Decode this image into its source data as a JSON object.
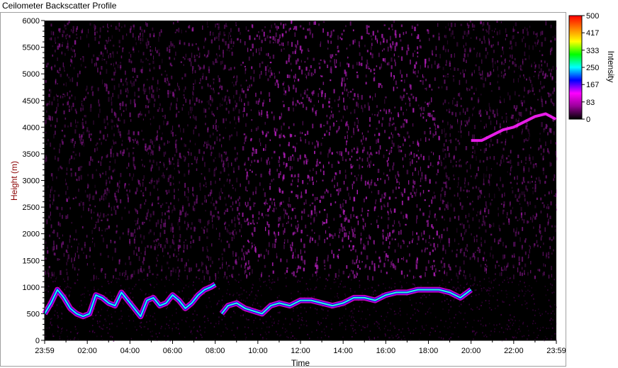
{
  "window": {
    "title": "Ceilometer Backscatter Profile"
  },
  "chart_data": {
    "type": "heatmap",
    "title": "",
    "xlabel": "Time",
    "ylabel": "Height (m)",
    "colorbar_label": "Intensity",
    "x_ticks": [
      "23:59",
      "02:00",
      "04:00",
      "06:00",
      "08:00",
      "10:00",
      "12:00",
      "14:00",
      "16:00",
      "18:00",
      "20:00",
      "22:00",
      "23:59"
    ],
    "y_ticks": [
      0,
      500,
      1000,
      1500,
      2000,
      2500,
      3000,
      3500,
      4000,
      4500,
      5000,
      5500,
      6000
    ],
    "ylim": [
      0,
      6000
    ],
    "xlim_hours": [
      0,
      24
    ],
    "colorbar_ticks": [
      500,
      417,
      333,
      250,
      167,
      83,
      0
    ],
    "colorbar_range": [
      0,
      500
    ],
    "colorbar_colors": [
      "#000000",
      "#9a009a",
      "#ff00ff",
      "#0000ff",
      "#00ffff",
      "#00ff00",
      "#ffff00",
      "#ff8000",
      "#ff0000"
    ],
    "background_noise_top_m": 6000,
    "dense_noise_ceiling_m": 1200,
    "cloud_base_layer": {
      "time_h": [
        0.0,
        0.3,
        0.6,
        0.9,
        1.2,
        1.5,
        1.8,
        2.1,
        2.4,
        2.7,
        3.0,
        3.3,
        3.6,
        3.9,
        4.2,
        4.5,
        4.8,
        5.1,
        5.4,
        5.7,
        6.0,
        6.3,
        6.6,
        6.9,
        7.2,
        7.5,
        7.8,
        8.0
      ],
      "height_m": [
        500,
        700,
        950,
        800,
        600,
        500,
        450,
        500,
        850,
        800,
        700,
        650,
        900,
        750,
        600,
        450,
        750,
        800,
        650,
        700,
        850,
        750,
        600,
        700,
        850,
        950,
        1000,
        1050
      ]
    },
    "cloud_base_layer_2": {
      "time_h": [
        8.3,
        8.6,
        9.0,
        9.4,
        9.8,
        10.2,
        10.6,
        11.0,
        11.5,
        12.0,
        12.5,
        13.0,
        13.5,
        14.0,
        14.5,
        15.0,
        15.5,
        16.0,
        16.5,
        17.0,
        17.5,
        18.0,
        18.5,
        19.0,
        19.5,
        20.0
      ],
      "height_m": [
        500,
        650,
        700,
        600,
        550,
        500,
        650,
        700,
        650,
        750,
        750,
        700,
        650,
        700,
        800,
        800,
        750,
        850,
        900,
        900,
        950,
        950,
        950,
        900,
        800,
        950
      ]
    },
    "upper_layer": {
      "time_h": [
        20.0,
        20.5,
        21.0,
        21.5,
        22.0,
        22.5,
        23.0,
        23.5,
        23.98
      ],
      "height_m": [
        3750,
        3750,
        3850,
        3950,
        4000,
        4100,
        4200,
        4250,
        4150
      ]
    }
  }
}
